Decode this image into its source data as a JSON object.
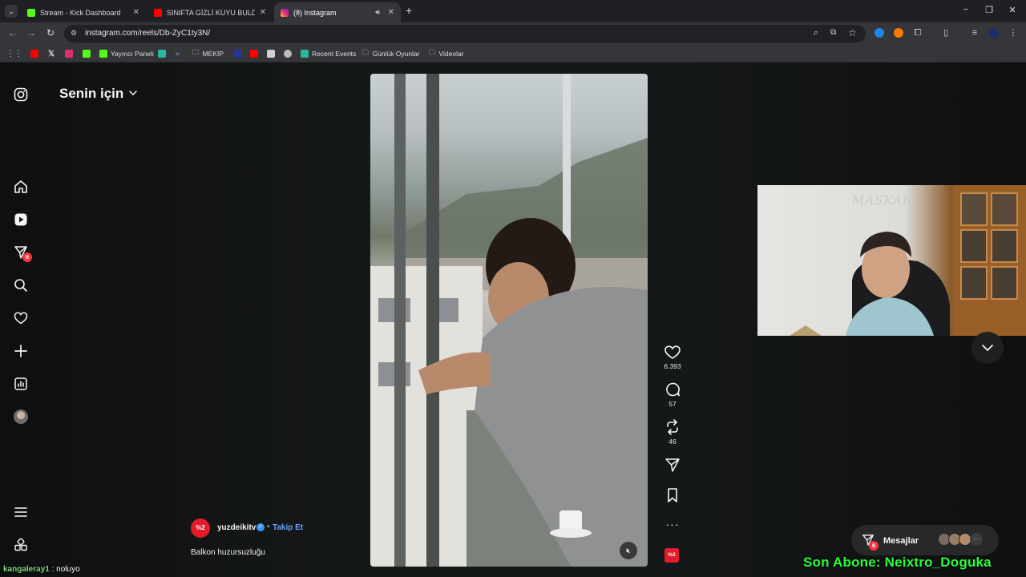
{
  "browser": {
    "tabs": [
      {
        "title": "Stream - Kick Dashboard",
        "favicon_color": "#53fc18"
      },
      {
        "title": "SINIFTA GİZLİ KUYU BULDUK!",
        "favicon_color": "#ff0000"
      },
      {
        "title": "(8) Instagram",
        "favicon_color": "#e1306c"
      }
    ],
    "url": "instagram.com/reels/Db-ZyC1ty3N/",
    "bookmarks": [
      {
        "label": "Yayıncı Paneli"
      },
      {
        "label": "MEKİP"
      },
      {
        "label": "Recent Events"
      },
      {
        "label": "Günlük Oyunlar"
      },
      {
        "label": "Videolar"
      }
    ]
  },
  "instagram": {
    "feed_title": "Senin için",
    "notification_badge": "8",
    "reel": {
      "likes": "6.393",
      "comments": "57",
      "reposts": "46",
      "author": "yuzdeikitv",
      "author_avatar_text": "%2",
      "follow_label": "Takip Et",
      "separator": "•",
      "caption": "Balkon huzursuzluğu"
    },
    "messages": {
      "label": "Mesajlar",
      "badge": "8"
    }
  },
  "overlay": {
    "webcam_sign": "MASKAR",
    "chat_user": "kangaleray1",
    "chat_message": " : noluyo",
    "last_sub": "Son Abone: Neixtro_Doguka"
  },
  "colors": {
    "instagram_red": "#e21c2b",
    "follow_blue": "#6d9ff7",
    "sub_green": "#26ff3a"
  }
}
